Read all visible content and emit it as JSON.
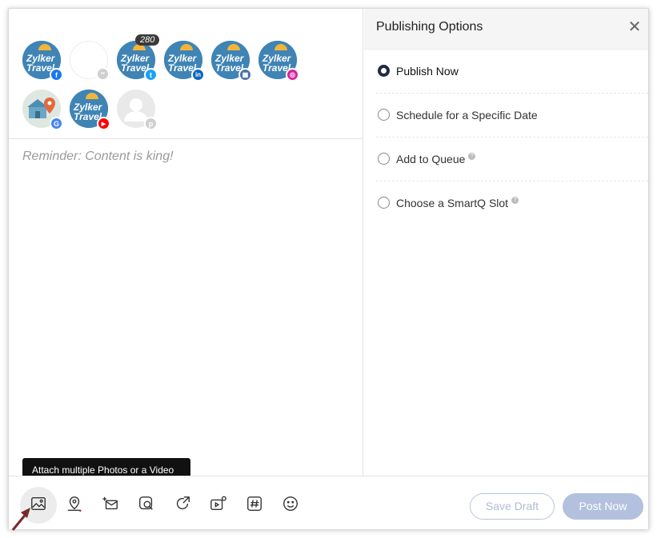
{
  "profiles": {
    "row1": [
      {
        "name": "Zylker Travel",
        "network": "facebook",
        "network_icon": "facebook-icon",
        "color": "#1877f2",
        "glyph": "f"
      },
      {
        "name": "",
        "network": "group",
        "network_icon": "group-icon",
        "color": "#c9c9c9",
        "glyph": "••"
      },
      {
        "name": "Zylker Travel",
        "network": "twitter",
        "network_icon": "twitter-icon",
        "color": "#1da1f2",
        "glyph": "t",
        "count": "280"
      },
      {
        "name": "Zylker Travel",
        "network": "linkedin",
        "network_icon": "linkedin-icon",
        "color": "#0a66c2",
        "glyph": "in"
      },
      {
        "name": "Zylker Travel",
        "network": "business",
        "network_icon": "building-icon",
        "color": "#4a6fa5",
        "glyph": "▦"
      },
      {
        "name": "Zylker Travel",
        "network": "instagram",
        "network_icon": "instagram-icon",
        "color": "#d6249f",
        "glyph": "◎"
      }
    ],
    "row2": [
      {
        "name": "",
        "network": "google",
        "network_icon": "google-icon",
        "color": "#4285f4",
        "glyph": "G"
      },
      {
        "name": "Zylker Travel",
        "network": "youtube",
        "network_icon": "youtube-icon",
        "color": "#ff0000",
        "glyph": "▶"
      },
      {
        "name": "",
        "network": "pinterest",
        "network_icon": "pinterest-icon",
        "color": "#c9c9c9",
        "glyph": "p"
      }
    ],
    "logo_line1": "Zylker",
    "logo_line2": "Travel"
  },
  "compose": {
    "placeholder": "Reminder: Content is king!"
  },
  "publishing": {
    "title": "Publishing Options",
    "options": [
      {
        "label": "Publish Now",
        "selected": true
      },
      {
        "label": "Schedule for a Specific Date",
        "selected": false
      },
      {
        "label": "Add to Queue",
        "selected": false,
        "help": "?"
      },
      {
        "label": "Choose a SmartQ Slot",
        "selected": false,
        "help": "?"
      }
    ]
  },
  "toolbar": {
    "tooltip": "Attach multiple Photos or a Video",
    "tools": [
      "image-icon",
      "location-icon",
      "mail-add-icon",
      "search-image-icon",
      "share-icon",
      "video-settings-icon",
      "hashtag-icon",
      "emoji-icon"
    ]
  },
  "actions": {
    "save_draft": "Save Draft",
    "post_now": "Post Now"
  }
}
